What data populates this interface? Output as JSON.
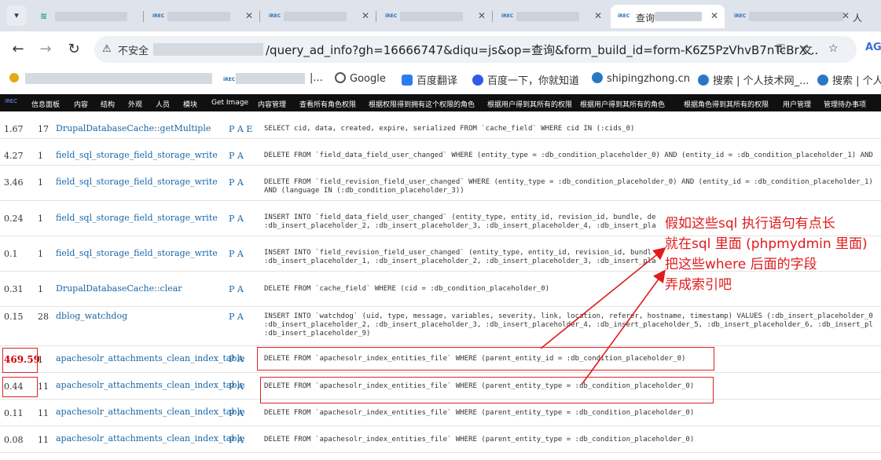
{
  "tabs": [
    {
      "label": "",
      "active": false
    },
    {
      "label": "",
      "active": false
    },
    {
      "label": "",
      "active": false
    },
    {
      "label": "",
      "active": false
    },
    {
      "label": "",
      "active": false
    },
    {
      "label": "查询",
      "active": true
    },
    {
      "label": "人",
      "active": false
    }
  ],
  "address": {
    "security": "不安全",
    "url_visible": "/query_ad_info?gh=16666747&diqu=js&op=查询&form_build_id=form-K6Z5PzVhvB7nTcBrX..."
  },
  "bookmarks": [
    {
      "label": "Google",
      "icon": "globe-icon"
    },
    {
      "label": "百度翻译",
      "icon": "translate-icon"
    },
    {
      "label": "百度一下，你就知道",
      "icon": "baidu-paw-icon"
    },
    {
      "label": "shipingzhong.cn",
      "icon": "drupal-icon"
    },
    {
      "label": "搜索 | 个人技术网_...",
      "icon": "drupal-icon"
    },
    {
      "label": "搜索 | 个人",
      "icon": "drupal-icon"
    }
  ],
  "bookmark_fragment": "|...",
  "admin_menu": [
    "信息面板",
    "内容",
    "结构",
    "外观",
    "人员",
    "模块",
    "Get Image",
    "内容管理",
    "查看所有角色权限",
    "根据权限得到拥有这个权限的角色",
    "根据用户得到其所有的权限",
    "根据用户得到其所有的角色",
    "根据角色得到其所有的权限",
    "用户管理",
    "管理待办事项"
  ],
  "query_rows": [
    {
      "time": "1.67",
      "count": "17",
      "function": "DrupalDatabaseCache::getMultiple",
      "flags": "P A E",
      "sql": "SELECT cid, data, created, expire, serialized FROM `cache_field` WHERE cid IN (:cids_0)",
      "highlight": false
    },
    {
      "time": "4.27",
      "count": "1",
      "function": "field_sql_storage_field_storage_write",
      "flags": "P A",
      "sql": "DELETE FROM `field_data_field_user_changed` WHERE (entity_type = :db_condition_placeholder_0) AND (entity_id = :db_condition_placeholder_1) AND",
      "highlight": false
    },
    {
      "time": "3.46",
      "count": "1",
      "function": "field_sql_storage_field_storage_write",
      "flags": "P A",
      "sql": "DELETE FROM `field_revision_field_user_changed` WHERE (entity_type = :db_condition_placeholder_0) AND (entity_id = :db_condition_placeholder_1)\nAND (language IN (:db_condition_placeholder_3))",
      "highlight": false
    },
    {
      "time": "0.24",
      "count": "1",
      "function": "field_sql_storage_field_storage_write",
      "flags": "P A",
      "sql": "INSERT INTO `field_data_field_user_changed` (entity_type, entity_id, revision_id, bundle, de\n:db_insert_placeholder_2, :db_insert_placeholder_3, :db_insert_placeholder_4, :db_insert_pla",
      "highlight": false
    },
    {
      "time": "0.1",
      "count": "1",
      "function": "field_sql_storage_field_storage_write",
      "flags": "P A",
      "sql": "INSERT INTO `field_revision_field_user_changed` (entity_type, entity_id, revision_id, bundl\n:db_insert_placeholder_1, :db_insert_placeholder_2, :db_insert_placeholder_3, :db_insert_pla",
      "highlight": false
    },
    {
      "time": "0.31",
      "count": "1",
      "function": "DrupalDatabaseCache::clear",
      "flags": "P A",
      "sql": "DELETE FROM `cache_field` WHERE (cid = :db_condition_placeholder_0)",
      "highlight": false
    },
    {
      "time": "0.15",
      "count": "28",
      "function": "dblog_watchdog",
      "flags": "P A",
      "sql": "INSERT INTO `watchdog` (uid, type, message, variables, severity, link, location, referer, hostname, timestamp) VALUES (:db_insert_placeholder_0\n:db_insert_placeholder_2, :db_insert_placeholder_3, :db_insert_placeholder_4, :db_insert_placeholder_5, :db_insert_placeholder_6, :db_insert_pl\n:db_insert_placeholder_9)",
      "highlight": false
    },
    {
      "time": "469.59",
      "count": "1",
      "function": "apachesolr_attachments_clean_index_table",
      "flags": "P A",
      "sql": "DELETE FROM `apachesolr_index_entities_file` WHERE (parent_entity_id = :db_condition_placeholder_0)",
      "highlight": true
    },
    {
      "time": "0.44",
      "count": "11",
      "function": "apachesolr_attachments_clean_index_table",
      "flags": "P A",
      "sql": "DELETE FROM `apachesolr_index_entities_file` WHERE (parent_entity_type = :db_condition_placeholder_0)",
      "highlight": false
    },
    {
      "time": "0.11",
      "count": "11",
      "function": "apachesolr_attachments_clean_index_table",
      "flags": "P A",
      "sql": "DELETE FROM `apachesolr_index_entities_file` WHERE (parent_entity_type = :db_condition_placeholder_0)",
      "highlight": false
    },
    {
      "time": "0.08",
      "count": "11",
      "function": "apachesolr_attachments_clean_index_table",
      "flags": "P A",
      "sql": "DELETE FROM `apachesolr_index_entities_file` WHERE (parent_entity_type = :db_condition_placeholder_0)",
      "highlight": false
    }
  ],
  "annotation": {
    "lines": [
      "假如这些sql 执行语句有点长",
      "就在sql 里面 (phpmydmin 里面)",
      "把这些where 后面的字段",
      "弄成索引吧"
    ],
    "color": "#e01b1b"
  },
  "colors": {
    "link": "#1a66a6",
    "hot": "#cc0000",
    "admin_bar": "#101010"
  }
}
